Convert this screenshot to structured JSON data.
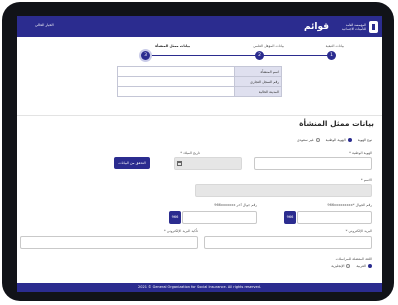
{
  "header": {
    "brand_text": "المؤسسة العامة للتأمينات الاجتماعية",
    "app_logo": "قوائم",
    "user_text": "الخيار الحالي"
  },
  "stepper": {
    "steps": [
      {
        "label": "بيانات التبعية",
        "number": "1"
      },
      {
        "label": "بيانات المؤهل العلمي",
        "number": "2"
      },
      {
        "label": "بيانات ممثل المنشأة",
        "number": "3"
      }
    ]
  },
  "info_table": {
    "rows": [
      {
        "label": "اسم المنشأة",
        "value": ""
      },
      {
        "label": "رقم السجل التجاري",
        "value": ""
      },
      {
        "label": "المدينة الحالية",
        "value": ""
      }
    ]
  },
  "section": {
    "title": "بيانات ممثل المنشأة"
  },
  "form": {
    "id_type_label": "نوع الهوية",
    "radio_national": "الهوية الوطنية",
    "radio_other": "غير سعودي",
    "national_id_label": "الهوية الوطنية *",
    "birth_date_label": "تاريخ الميلاد *",
    "verify_button": "التحقق من البيانات",
    "name_label": "الاسم *",
    "phone_label": "رقم الجوال *966xxxxxxxxx",
    "phone_button": "966",
    "alt_phone_label": "رقم جوال آخر 966xxxxxxx",
    "alt_phone_button": "966",
    "email_label": "البريد الإلكتروني *",
    "email_confirm_label": "تأكيد البريد الإلكتروني *",
    "language_label": "اللغة المفضلة للمراسلات",
    "lang_ar": "العربية",
    "lang_en": "الإنجليزية"
  },
  "footer": {
    "text": "2021 © General Organization for Social Insurance. All rights reserved."
  },
  "colors": {
    "primary": "#2b2c8f",
    "bezel": "#111318"
  }
}
